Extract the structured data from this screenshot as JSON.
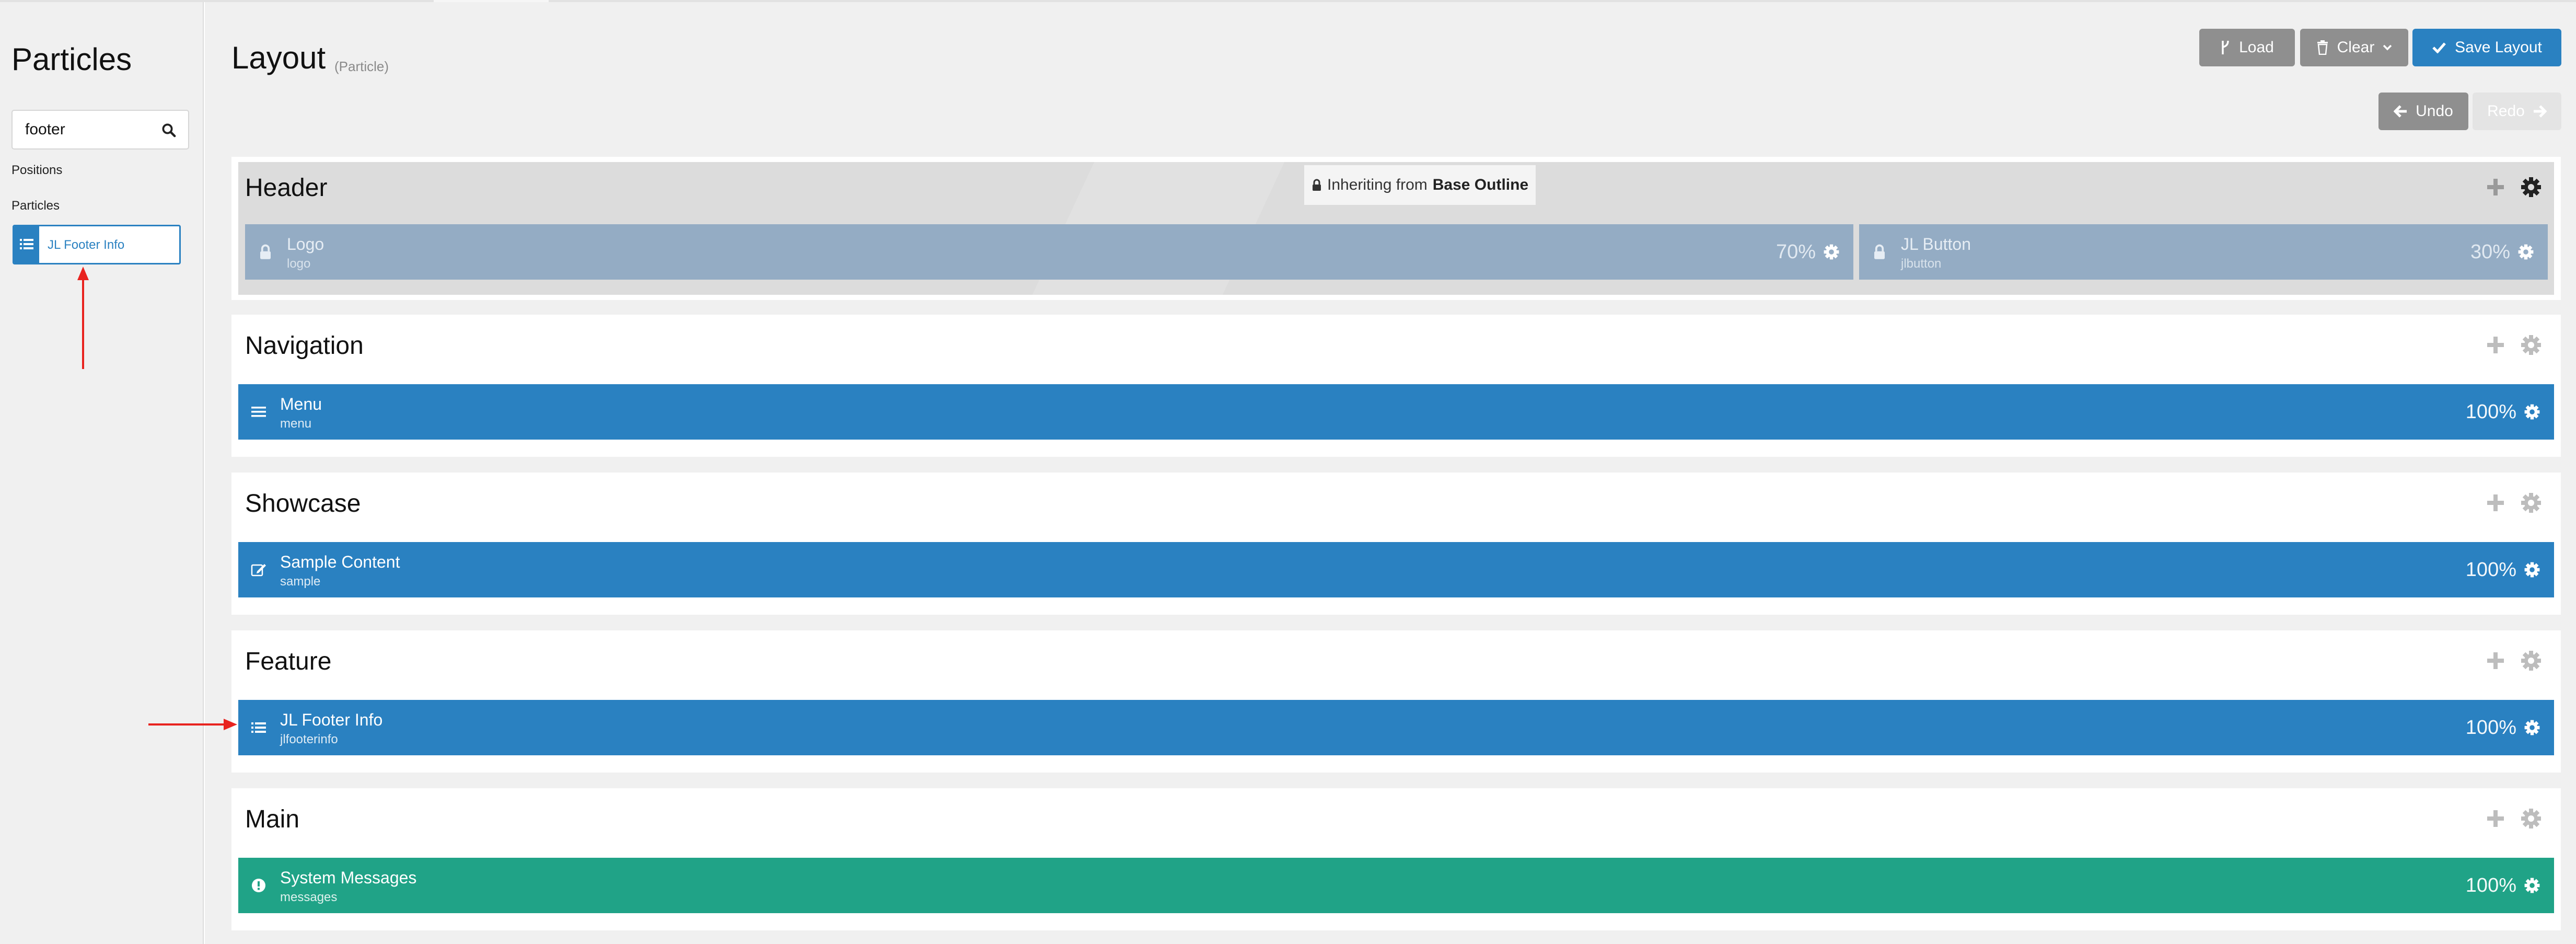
{
  "sidebar": {
    "title": "Particles",
    "search": {
      "value": "footer",
      "placeholder": ""
    },
    "positions_label": "Positions",
    "particles_label": "Particles",
    "result_item": {
      "label": "JL Footer Info",
      "icon": "list-icon"
    }
  },
  "header": {
    "title": "Layout",
    "subtitle": "(Particle)",
    "buttons": {
      "load": "Load",
      "clear": "Clear",
      "save": "Save Layout",
      "undo": "Undo",
      "redo": "Redo"
    }
  },
  "sections": {
    "header": {
      "title": "Header",
      "inherit_prefix": "Inheriting from",
      "inherit_source": "Base Outline",
      "particles": [
        {
          "title": "Logo",
          "sub": "logo",
          "percent": "70%",
          "icon": "lock-icon"
        },
        {
          "title": "JL Button",
          "sub": "jlbutton",
          "percent": "30%",
          "icon": "lock-icon"
        }
      ]
    },
    "navigation": {
      "title": "Navigation",
      "particles": [
        {
          "title": "Menu",
          "sub": "menu",
          "percent": "100%",
          "icon": "menu-icon"
        }
      ]
    },
    "showcase": {
      "title": "Showcase",
      "particles": [
        {
          "title": "Sample Content",
          "sub": "sample",
          "percent": "100%",
          "icon": "edit-icon"
        }
      ]
    },
    "feature": {
      "title": "Feature",
      "particles": [
        {
          "title": "JL Footer Info",
          "sub": "jlfooterinfo",
          "percent": "100%",
          "icon": "list-icon"
        }
      ]
    },
    "main": {
      "title": "Main",
      "particles": [
        {
          "title": "System Messages",
          "sub": "messages",
          "percent": "100%",
          "icon": "alert-icon"
        }
      ]
    }
  },
  "colors": {
    "accent_blue": "#2a81c1",
    "green": "#20a387",
    "locked_blue": "#94acc4",
    "annotation_red": "#e8231f"
  }
}
